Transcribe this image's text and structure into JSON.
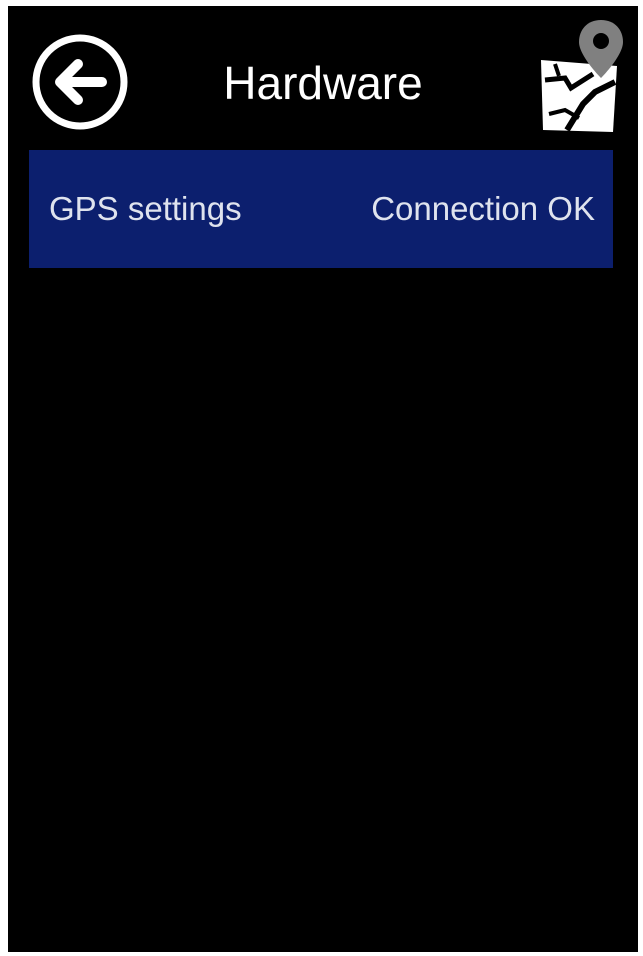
{
  "header": {
    "title": "Hardware",
    "back_icon": "arrow-left-circle-icon",
    "map_icon": "map-pin-icon"
  },
  "hardware_list": {
    "items": [
      {
        "label": "GPS settings",
        "status": "Connection OK"
      }
    ]
  },
  "colors": {
    "background": "#000000",
    "row_background": "#0c1f6e",
    "text": "#ffffff",
    "row_text": "#dfe3ee"
  }
}
